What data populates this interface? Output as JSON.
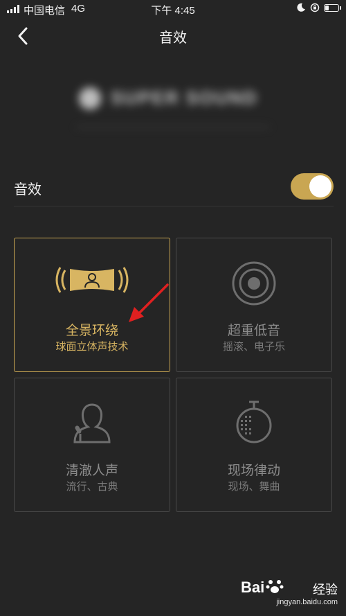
{
  "status": {
    "carrier": "中国电信",
    "network": "4G",
    "time": "下午 4:45"
  },
  "nav": {
    "title": "音效"
  },
  "settings": {
    "effect_label": "音效",
    "effect_enabled": true
  },
  "cards": [
    {
      "title": "全景环绕",
      "subtitle": "球面立体声技术",
      "icon": "surround-icon",
      "active": true
    },
    {
      "title": "超重低音",
      "subtitle": "摇滚、电子乐",
      "icon": "speaker-icon",
      "active": false
    },
    {
      "title": "清澈人声",
      "subtitle": "流行、古典",
      "icon": "vocal-icon",
      "active": false
    },
    {
      "title": "现场律动",
      "subtitle": "现场、舞曲",
      "icon": "disco-ball-icon",
      "active": false
    }
  ],
  "watermark": {
    "logo": "Bai",
    "text": "经验",
    "url": "jingyan.baidu.com"
  },
  "colors": {
    "background": "#252525",
    "accent": "#c9a652",
    "card_border": "#4a4a4a",
    "arrow": "#e02020"
  }
}
